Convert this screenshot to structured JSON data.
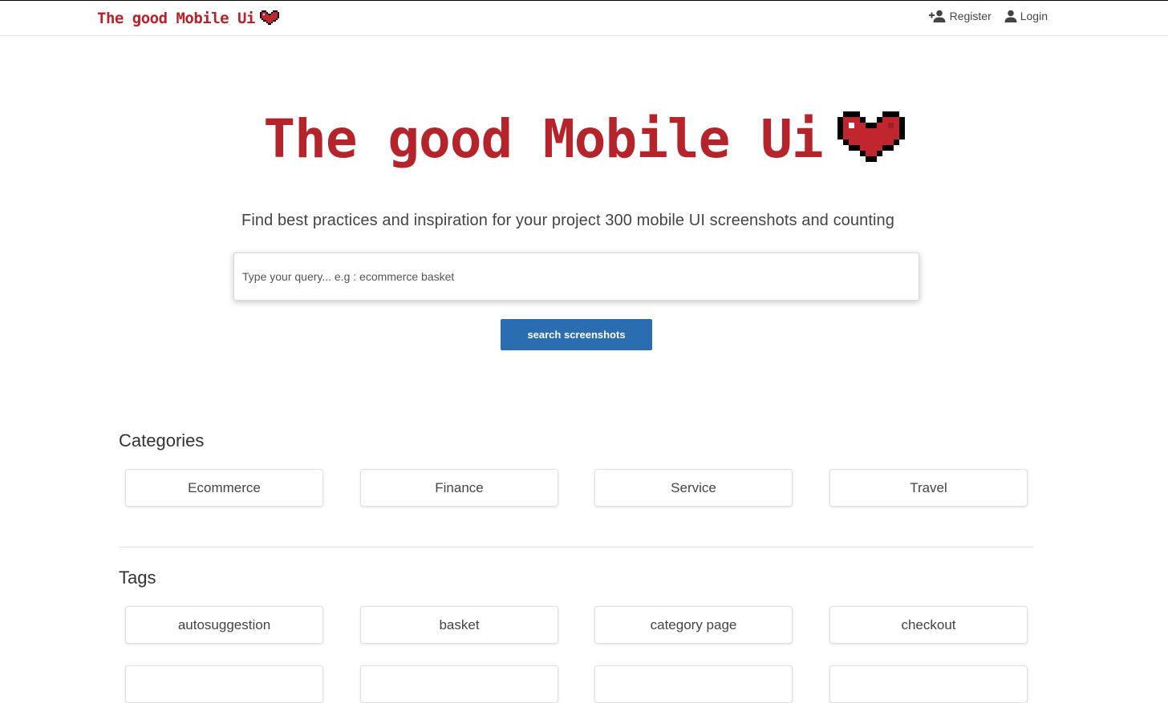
{
  "nav": {
    "brand": "The good Mobile Ui",
    "register_label": "Register",
    "login_label": "Login"
  },
  "hero": {
    "title": "The good Mobile Ui",
    "subtitle": "Find best practices and inspiration for your project 300 mobile UI screenshots and counting"
  },
  "search": {
    "placeholder": "Type your query... e.g : ecommerce basket",
    "value": "",
    "button_label": "search screenshots"
  },
  "categories": {
    "title": "Categories",
    "items": [
      "Ecommerce",
      "Finance",
      "Service",
      "Travel"
    ]
  },
  "tags": {
    "title": "Tags",
    "items": [
      "autosuggestion",
      "basket",
      "category page",
      "checkout",
      "",
      "",
      "",
      ""
    ]
  },
  "icons": {
    "brand_heart": "heart-icon",
    "register": "add-user-icon",
    "login": "user-icon"
  },
  "colors": {
    "brand_red": "#b5242b",
    "heart_red": "#c0262d",
    "button_blue": "#2a6db0"
  }
}
